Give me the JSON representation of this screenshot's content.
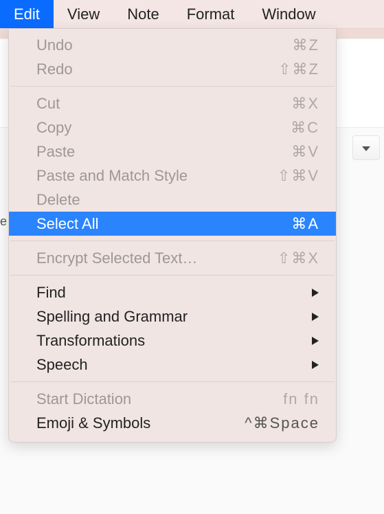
{
  "menubar": {
    "items": [
      {
        "label": "Edit",
        "active": true
      },
      {
        "label": "View",
        "active": false
      },
      {
        "label": "Note",
        "active": false
      },
      {
        "label": "Format",
        "active": false
      },
      {
        "label": "Window",
        "active": false
      }
    ]
  },
  "leftFragment": "e",
  "menu": {
    "groups": [
      [
        {
          "label": "Undo",
          "shortcut": "⌘Z",
          "state": "disabled"
        },
        {
          "label": "Redo",
          "shortcut": "⇧⌘Z",
          "state": "disabled"
        }
      ],
      [
        {
          "label": "Cut",
          "shortcut": "⌘X",
          "state": "disabled"
        },
        {
          "label": "Copy",
          "shortcut": "⌘C",
          "state": "disabled"
        },
        {
          "label": "Paste",
          "shortcut": "⌘V",
          "state": "disabled"
        },
        {
          "label": "Paste and Match Style",
          "shortcut": "⇧⌘V",
          "state": "disabled"
        },
        {
          "label": "Delete",
          "shortcut": "",
          "state": "disabled"
        },
        {
          "label": "Select All",
          "shortcut": "⌘A",
          "state": "selected"
        }
      ],
      [
        {
          "label": "Encrypt Selected Text…",
          "shortcut": "⇧⌘X",
          "state": "disabled"
        }
      ],
      [
        {
          "label": "Find",
          "submenu": true,
          "state": "enabled"
        },
        {
          "label": "Spelling and Grammar",
          "submenu": true,
          "state": "enabled"
        },
        {
          "label": "Transformations",
          "submenu": true,
          "state": "enabled"
        },
        {
          "label": "Speech",
          "submenu": true,
          "state": "enabled"
        }
      ],
      [
        {
          "label": "Start Dictation",
          "shortcut": "fn fn",
          "state": "disabled"
        },
        {
          "label": "Emoji & Symbols",
          "shortcut": "^⌘Space",
          "state": "enabled"
        }
      ]
    ]
  }
}
